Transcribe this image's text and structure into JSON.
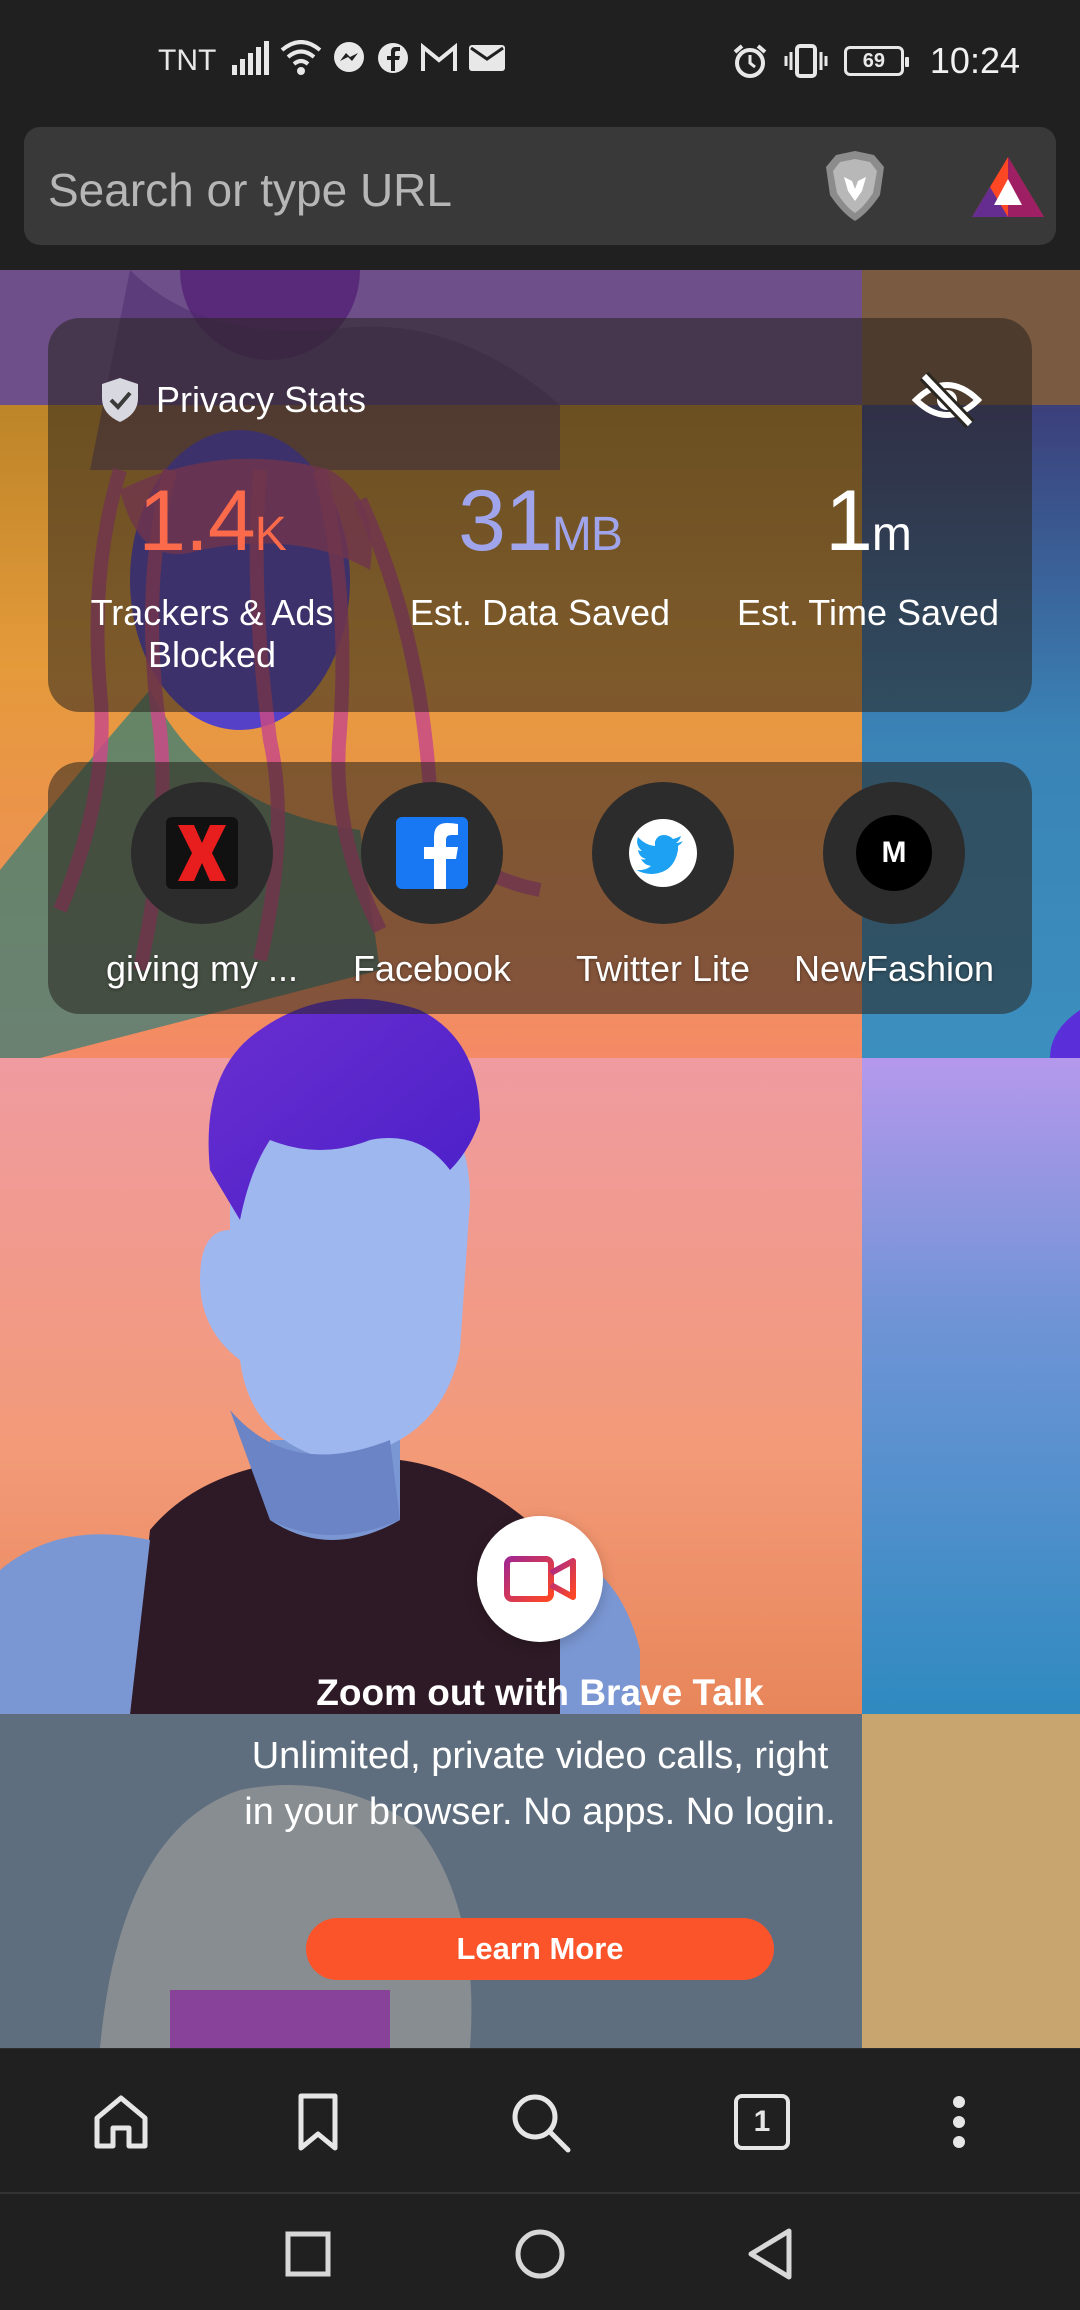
{
  "status_bar": {
    "carrier": "TNT",
    "battery": "69",
    "time": "10:24"
  },
  "url_bar": {
    "placeholder": "Search or type URL"
  },
  "privacy_stats": {
    "title": "Privacy Stats",
    "trackers": {
      "value": "1.4",
      "unit": "K",
      "label": "Trackers & Ads Blocked",
      "color": "#fb6a4b"
    },
    "data_saved": {
      "value": "31",
      "unit": "MB",
      "label": "Est. Data Saved",
      "color": "#a0a5eb"
    },
    "time_saved": {
      "value": "1",
      "unit": "m",
      "label": "Est. Time Saved",
      "color": "#ffffff"
    }
  },
  "top_sites": [
    {
      "label": "giving my ..."
    },
    {
      "label": "Facebook"
    },
    {
      "label": "Twitter Lite"
    },
    {
      "label": "NewFashion",
      "icon_letter": "M"
    }
  ],
  "promo": {
    "title": "Zoom out with Brave Talk",
    "body": "Unlimited, private video calls, right in your browser. No apps. No login.",
    "button": "Learn More",
    "accent": "#fb542b"
  },
  "toolbar": {
    "tab_count": "1"
  }
}
